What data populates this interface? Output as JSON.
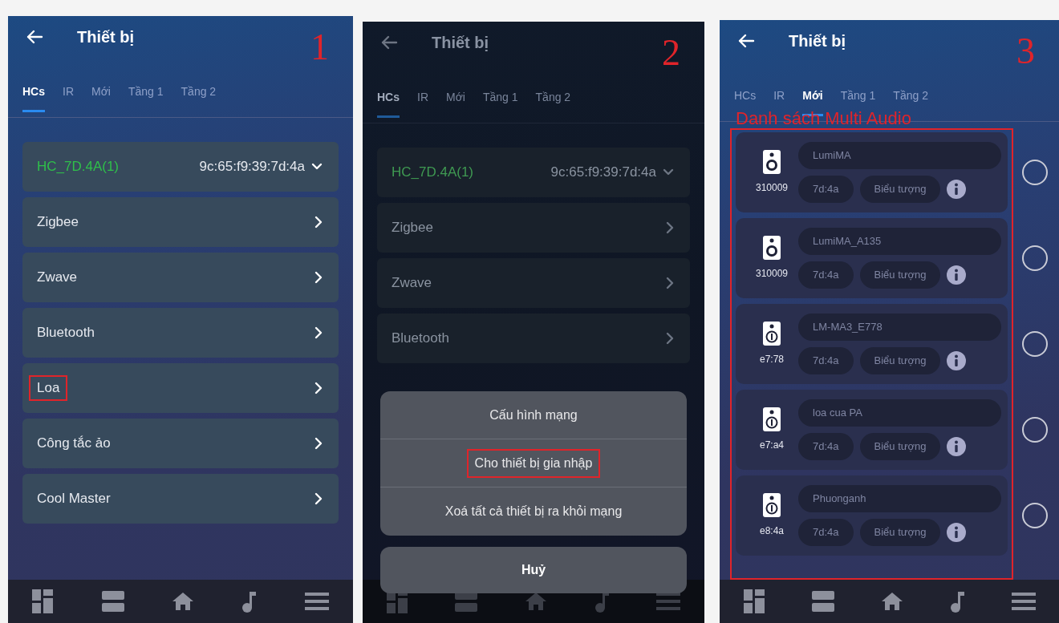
{
  "screens": [
    {
      "kind": "device-list",
      "annotation": "1",
      "title": "Thiết bị",
      "tabs": [
        {
          "label": "HCs",
          "selected": true
        },
        {
          "label": "IR",
          "selected": false
        },
        {
          "label": "Mới",
          "selected": false
        },
        {
          "label": "Tầng 1",
          "selected": false
        },
        {
          "label": "Tầng 2",
          "selected": false
        }
      ],
      "hc": {
        "name": "HC_7D.4A(1)",
        "mac": "9c:65:f9:39:7d:4a"
      },
      "items": [
        {
          "label": "Zigbee",
          "highlighted": false
        },
        {
          "label": "Zwave",
          "highlighted": false
        },
        {
          "label": "Bluetooth",
          "highlighted": false
        },
        {
          "label": "Loa",
          "highlighted": true
        },
        {
          "label": "Công tắc ảo",
          "highlighted": false
        },
        {
          "label": "Cool Master",
          "highlighted": false
        }
      ]
    },
    {
      "kind": "action-sheet",
      "annotation": "2",
      "title": "Thiết bị",
      "tabs": [
        {
          "label": "HCs",
          "selected": true
        },
        {
          "label": "IR",
          "selected": false
        },
        {
          "label": "Mới",
          "selected": false
        },
        {
          "label": "Tầng 1",
          "selected": false
        },
        {
          "label": "Tầng 2",
          "selected": false
        }
      ],
      "hc": {
        "name": "HC_7D.4A(1)",
        "mac": "9c:65:f9:39:7d:4a"
      },
      "items": [
        {
          "label": "Zigbee",
          "highlighted": false
        },
        {
          "label": "Zwave",
          "highlighted": false
        },
        {
          "label": "Bluetooth",
          "highlighted": false
        }
      ],
      "sheet": {
        "options": [
          {
            "label": "Cấu hình mạng",
            "highlighted": false
          },
          {
            "label": "Cho thiết bị gia nhập",
            "highlighted": true
          },
          {
            "label": "Xoá tất cả thiết bị ra khỏi mạng",
            "highlighted": false
          }
        ],
        "cancel": "Huỷ"
      }
    },
    {
      "kind": "audio-list",
      "annotation": "3",
      "title": "Thiết bị",
      "tabs": [
        {
          "label": "HCs",
          "selected": false
        },
        {
          "label": "IR",
          "selected": false
        },
        {
          "label": "Mới",
          "selected": true
        },
        {
          "label": "Tầng 1",
          "selected": false
        },
        {
          "label": "Tầng 2",
          "selected": false
        }
      ],
      "caption": "Danh sách Multi Audio",
      "list_highlighted": true,
      "devices": [
        {
          "kind": "speaker",
          "name": "LumiMA",
          "code": "310009",
          "mac": "7d:4a",
          "icon_button": "Biểu tượng",
          "selected": false
        },
        {
          "kind": "speaker",
          "name": "LumiMA_A135",
          "code": "310009",
          "mac": "7d:4a",
          "icon_button": "Biểu tượng",
          "selected": false
        },
        {
          "kind": "speaker-dial",
          "name": "LM-MA3_E778",
          "code": "e7:78",
          "mac": "7d:4a",
          "icon_button": "Biểu tượng",
          "selected": false
        },
        {
          "kind": "speaker-dial",
          "name": "loa cua PA",
          "code": "e7:a4",
          "mac": "7d:4a",
          "icon_button": "Biểu tượng",
          "selected": false
        },
        {
          "kind": "speaker-dial",
          "name": "Phuonganh",
          "code": "e8:4a",
          "mac": "7d:4a",
          "icon_button": "Biểu tượng",
          "selected": false
        }
      ]
    }
  ]
}
